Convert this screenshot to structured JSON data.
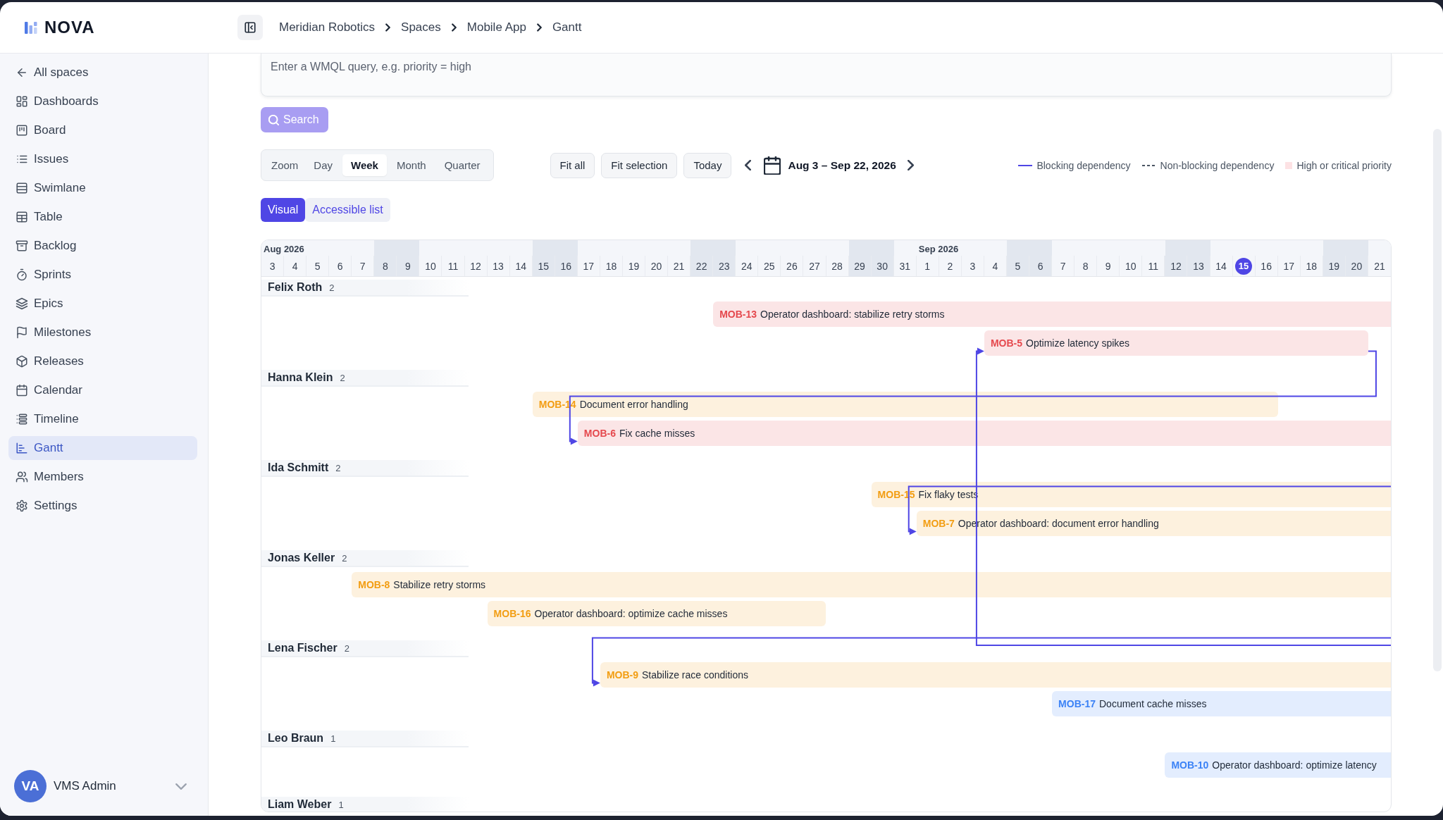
{
  "app": {
    "name": "NOVA"
  },
  "header": {
    "breadcrumb": [
      "Meridian Robotics",
      "Spaces",
      "Mobile App",
      "Gantt"
    ]
  },
  "sidebar": {
    "items": [
      {
        "label": "All spaces",
        "selected": false
      },
      {
        "label": "Dashboards",
        "selected": false
      },
      {
        "label": "Board",
        "selected": false
      },
      {
        "label": "Issues",
        "selected": false
      },
      {
        "label": "Swimlane",
        "selected": false
      },
      {
        "label": "Table",
        "selected": false
      },
      {
        "label": "Backlog",
        "selected": false
      },
      {
        "label": "Sprints",
        "selected": false
      },
      {
        "label": "Epics",
        "selected": false
      },
      {
        "label": "Milestones",
        "selected": false
      },
      {
        "label": "Releases",
        "selected": false
      },
      {
        "label": "Calendar",
        "selected": false
      },
      {
        "label": "Timeline",
        "selected": false
      },
      {
        "label": "Gantt",
        "selected": true
      },
      {
        "label": "Members",
        "selected": false
      },
      {
        "label": "Settings",
        "selected": false
      }
    ],
    "user": {
      "initials": "VA",
      "name": "VMS Admin"
    }
  },
  "query": {
    "placeholder": "Enter a WMQL query, e.g. priority = high"
  },
  "search_button": {
    "label": "Search",
    "disabled": true
  },
  "zoom": {
    "label": "Zoom",
    "options": [
      {
        "label": "Day",
        "selected": false
      },
      {
        "label": "Week",
        "selected": true
      },
      {
        "label": "Month",
        "selected": false
      },
      {
        "label": "Quarter",
        "selected": false
      }
    ]
  },
  "actions": [
    "Fit all",
    "Fit selection",
    "Today"
  ],
  "range": {
    "label": "Aug 3 – Sep 22, 2026"
  },
  "legend": [
    {
      "kind": "solid",
      "label": "Blocking dependency"
    },
    {
      "kind": "dashed",
      "label": "Non-blocking dependency"
    },
    {
      "kind": "swatch",
      "label": "High or critical priority"
    }
  ],
  "views": [
    {
      "label": "Visual",
      "selected": true
    },
    {
      "label": "Accessible list",
      "selected": false
    }
  ],
  "gantt": {
    "months": [
      {
        "label": "Aug 2026",
        "days": [
          {
            "label": "3",
            "weekend": false,
            "today": false
          },
          {
            "label": "4",
            "weekend": false,
            "today": false
          },
          {
            "label": "5",
            "weekend": false,
            "today": false
          },
          {
            "label": "6",
            "weekend": false,
            "today": false
          },
          {
            "label": "7",
            "weekend": false,
            "today": false
          },
          {
            "label": "8",
            "weekend": true,
            "today": false
          },
          {
            "label": "9",
            "weekend": true,
            "today": false
          },
          {
            "label": "10",
            "weekend": false,
            "today": false
          },
          {
            "label": "11",
            "weekend": false,
            "today": false
          },
          {
            "label": "12",
            "weekend": false,
            "today": false
          },
          {
            "label": "13",
            "weekend": false,
            "today": false
          },
          {
            "label": "14",
            "weekend": false,
            "today": false
          },
          {
            "label": "15",
            "weekend": true,
            "today": false
          },
          {
            "label": "16",
            "weekend": true,
            "today": false
          },
          {
            "label": "17",
            "weekend": false,
            "today": false
          },
          {
            "label": "18",
            "weekend": false,
            "today": false
          },
          {
            "label": "19",
            "weekend": false,
            "today": false
          },
          {
            "label": "20",
            "weekend": false,
            "today": false
          },
          {
            "label": "21",
            "weekend": false,
            "today": false
          },
          {
            "label": "22",
            "weekend": true,
            "today": false
          },
          {
            "label": "23",
            "weekend": true,
            "today": false
          },
          {
            "label": "24",
            "weekend": false,
            "today": false
          },
          {
            "label": "25",
            "weekend": false,
            "today": false
          },
          {
            "label": "26",
            "weekend": false,
            "today": false
          },
          {
            "label": "27",
            "weekend": false,
            "today": false
          },
          {
            "label": "28",
            "weekend": false,
            "today": false
          },
          {
            "label": "29",
            "weekend": true,
            "today": false
          },
          {
            "label": "30",
            "weekend": true,
            "today": false
          },
          {
            "label": "31",
            "weekend": false,
            "today": false
          }
        ]
      },
      {
        "label": "Sep 2026",
        "days": [
          {
            "label": "1",
            "weekend": false,
            "today": false
          },
          {
            "label": "2",
            "weekend": false,
            "today": false
          },
          {
            "label": "3",
            "weekend": false,
            "today": false
          },
          {
            "label": "4",
            "weekend": false,
            "today": false
          },
          {
            "label": "5",
            "weekend": true,
            "today": false
          },
          {
            "label": "6",
            "weekend": true,
            "today": false
          },
          {
            "label": "7",
            "weekend": false,
            "today": false
          },
          {
            "label": "8",
            "weekend": false,
            "today": false
          },
          {
            "label": "9",
            "weekend": false,
            "today": false
          },
          {
            "label": "10",
            "weekend": false,
            "today": false
          },
          {
            "label": "11",
            "weekend": false,
            "today": false
          },
          {
            "label": "12",
            "weekend": true,
            "today": false
          },
          {
            "label": "13",
            "weekend": true,
            "today": false
          },
          {
            "label": "14",
            "weekend": false,
            "today": false
          },
          {
            "label": "15",
            "weekend": false,
            "today": true
          },
          {
            "label": "16",
            "weekend": false,
            "today": false
          },
          {
            "label": "17",
            "weekend": false,
            "today": false
          },
          {
            "label": "18",
            "weekend": false,
            "today": false
          },
          {
            "label": "19",
            "weekend": true,
            "today": false
          },
          {
            "label": "20",
            "weekend": true,
            "today": false
          },
          {
            "label": "21",
            "weekend": false,
            "today": false
          }
        ]
      }
    ],
    "groups": [
      {
        "name": "Felix Roth",
        "count": "2",
        "tasks": [
          {
            "key": "MOB-13",
            "title": "Operator dashboard: stabilize retry storms",
            "color": "#e5484d"
          },
          {
            "key": "MOB-5",
            "title": "Optimize latency spikes",
            "color": "#e5484d"
          }
        ]
      },
      {
        "name": "Hanna Klein",
        "count": "2",
        "tasks": [
          {
            "key": "MOB-14",
            "title": "Document error handling",
            "color": "#f29d12"
          },
          {
            "key": "MOB-6",
            "title": "Fix cache misses",
            "color": "#e5484d"
          }
        ]
      },
      {
        "name": "Ida Schmitt",
        "count": "2",
        "tasks": [
          {
            "key": "MOB-15",
            "title": "Fix flaky tests",
            "color": "#f29d12"
          },
          {
            "key": "MOB-7",
            "title": "Operator dashboard: document error handling",
            "color": "#f29d12"
          }
        ]
      },
      {
        "name": "Jonas Keller",
        "count": "2",
        "tasks": [
          {
            "key": "MOB-8",
            "title": "Stabilize retry storms",
            "color": "#f29d12"
          },
          {
            "key": "MOB-16",
            "title": "Operator dashboard: optimize cache misses",
            "color": "#f29d12"
          }
        ]
      },
      {
        "name": "Lena Fischer",
        "count": "2",
        "tasks": [
          {
            "key": "MOB-9",
            "title": "Stabilize race conditions",
            "color": "#f29d12"
          },
          {
            "key": "MOB-17",
            "title": "Document cache misses",
            "color": "#3b82f6"
          }
        ]
      },
      {
        "name": "Leo Braun",
        "count": "1",
        "tasks": [
          {
            "key": "MOB-10",
            "title": "Operator dashboard: optimize latency",
            "color": "#3b82f6"
          }
        ]
      },
      {
        "name": "Liam Weber",
        "count": "1"
      }
    ],
    "dependencies": [
      {
        "kind": "blocking"
      },
      {
        "kind": "blocking"
      },
      {
        "kind": "blocking"
      },
      {
        "kind": "blocking"
      }
    ]
  }
}
